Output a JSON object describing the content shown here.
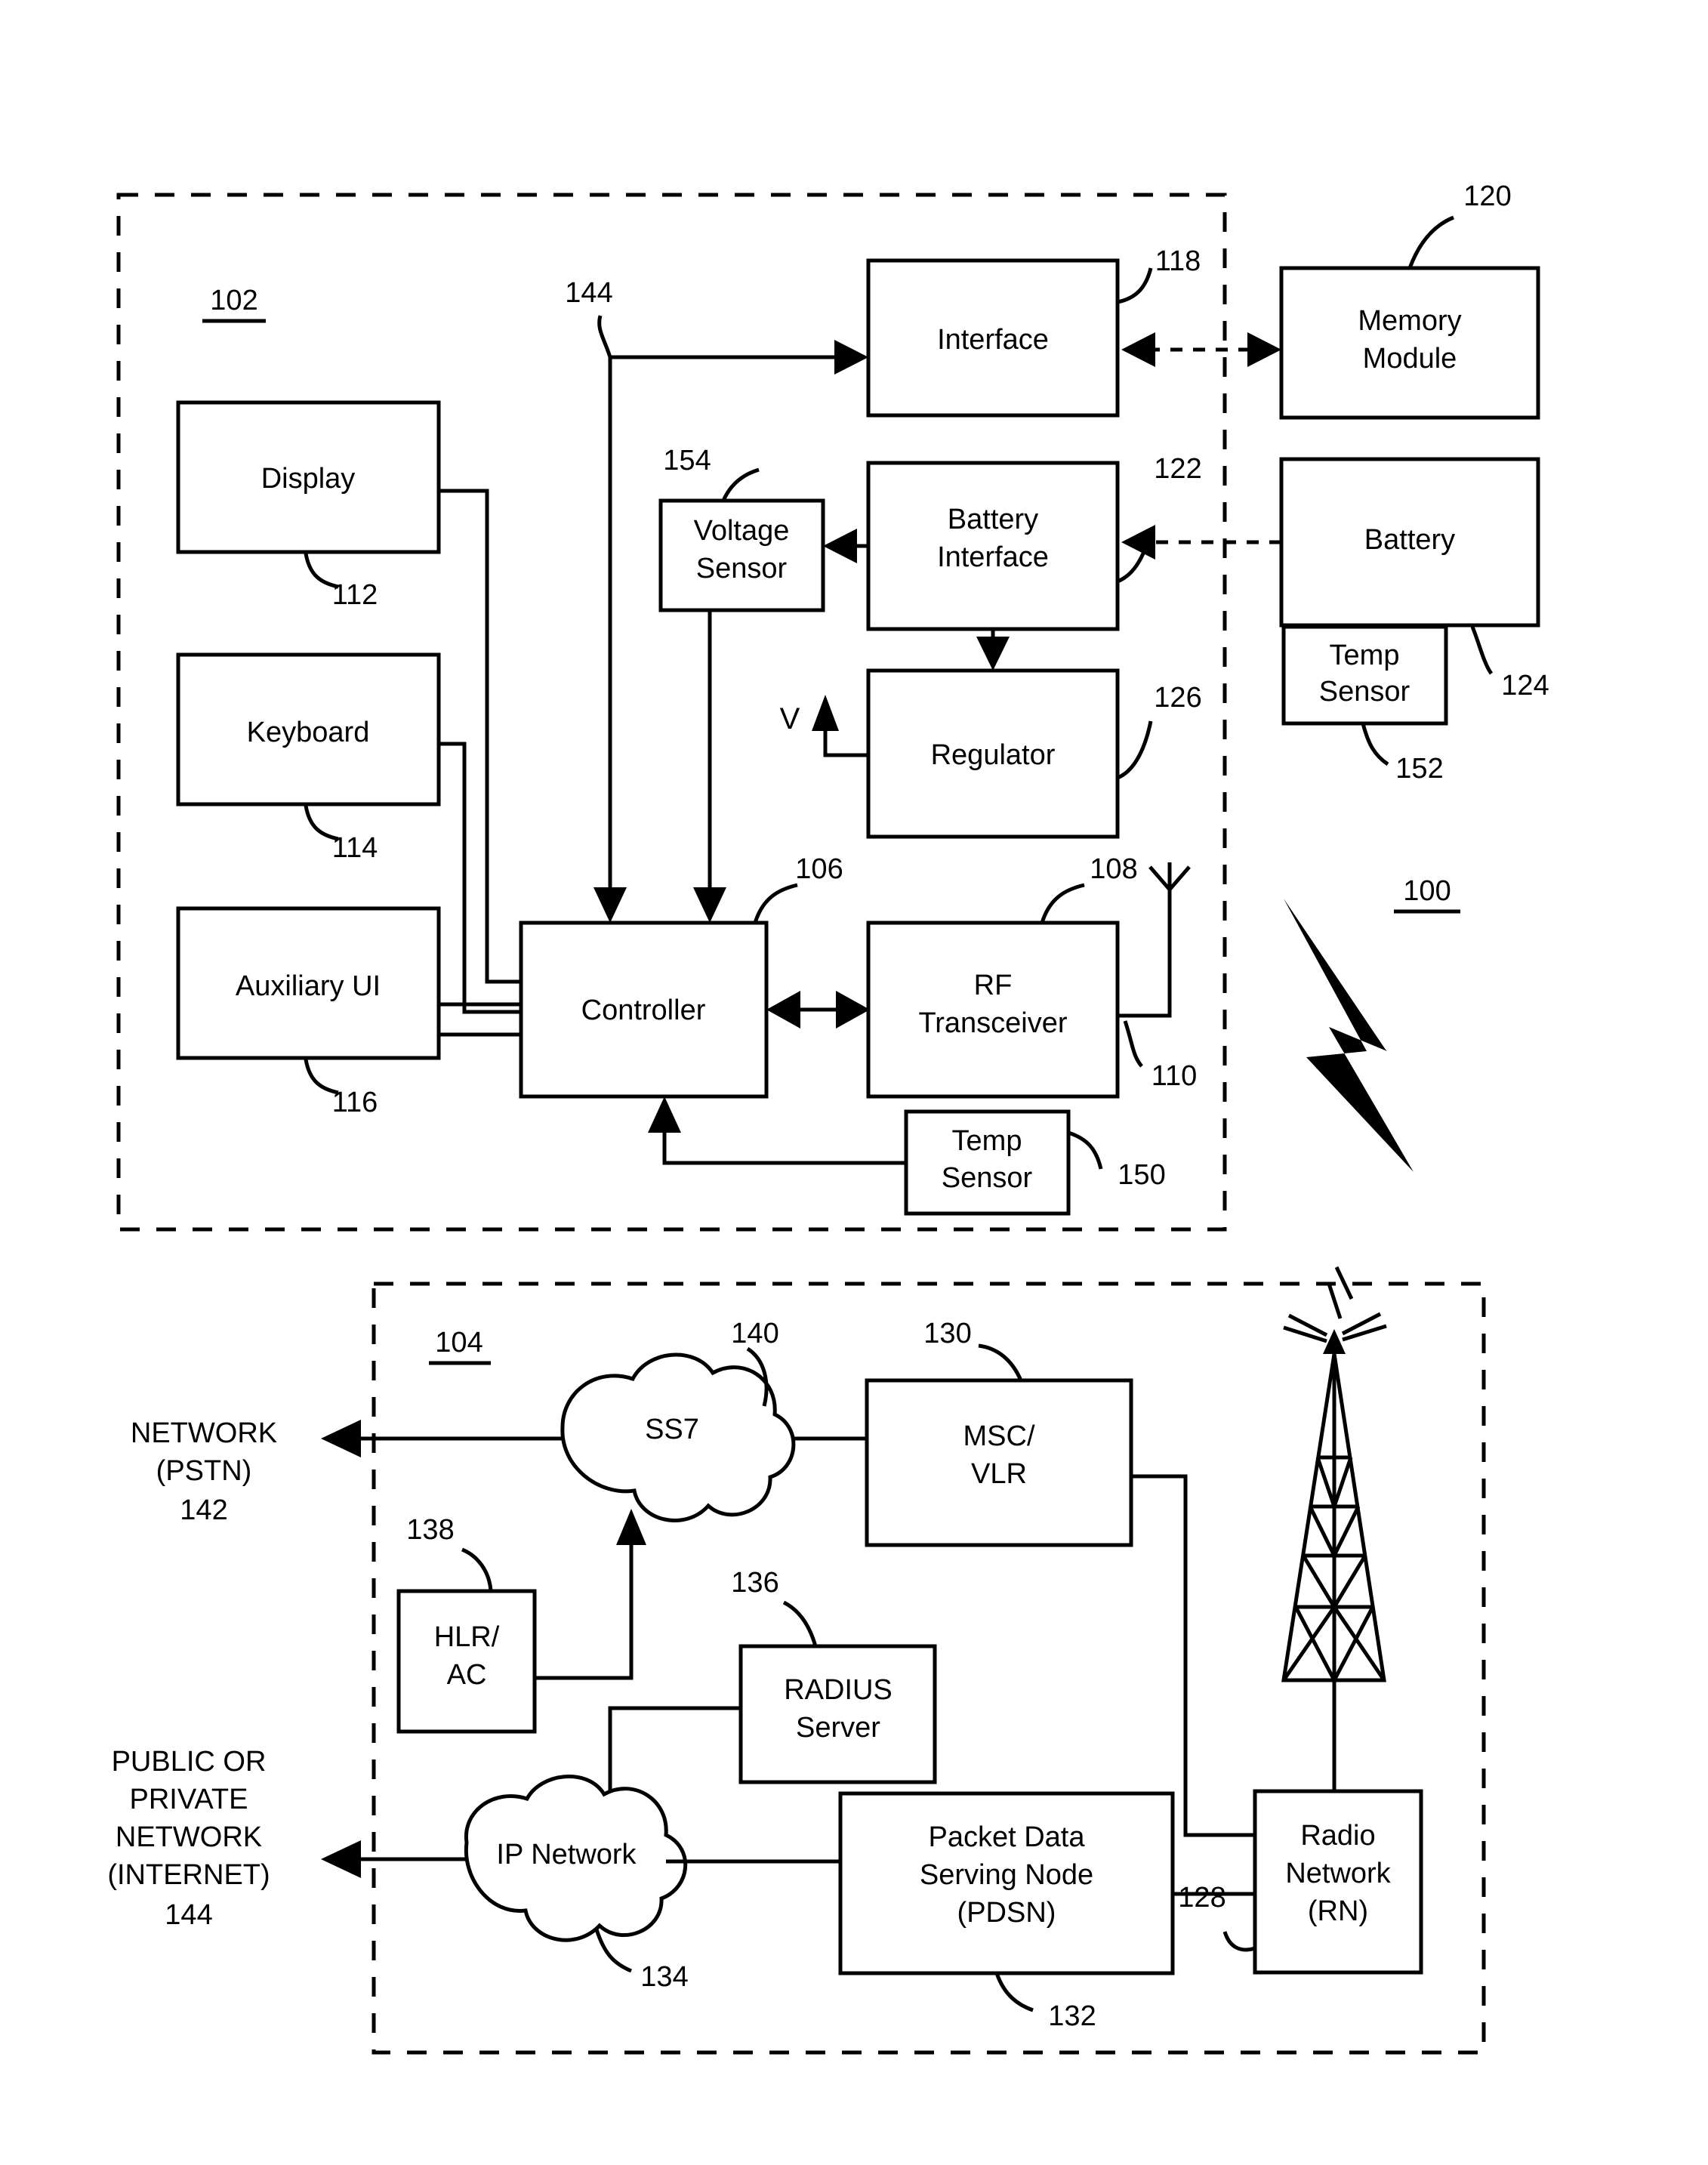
{
  "figure": {
    "type": "patent-block-diagram",
    "overall_ref": "100"
  },
  "mobile_device": {
    "enclosure_ref": "102",
    "blocks": [
      {
        "id": "display",
        "label": "Display",
        "ref": "112"
      },
      {
        "id": "keyboard",
        "label": "Keyboard",
        "ref": "114"
      },
      {
        "id": "auxiliary_ui",
        "label": "Auxiliary UI",
        "ref": "116"
      },
      {
        "id": "controller",
        "label": "Controller",
        "ref": "106"
      },
      {
        "id": "rf_transceiver",
        "label": "RF Transceiver",
        "ref": "108"
      },
      {
        "id": "antenna",
        "label": "",
        "ref": "110"
      },
      {
        "id": "interface",
        "label": "Interface",
        "ref": "118"
      },
      {
        "id": "battery_interface",
        "label": "Battery Interface",
        "ref": "122"
      },
      {
        "id": "voltage_sensor",
        "label": "Voltage Sensor",
        "ref": "154"
      },
      {
        "id": "regulator",
        "label": "Regulator",
        "ref": "126"
      },
      {
        "id": "temp_sensor_dev",
        "label": "Temp Sensor",
        "ref": "150"
      }
    ],
    "bus_ref": "144",
    "regulator_output_label": "V"
  },
  "battery_pack": {
    "blocks": [
      {
        "id": "memory_module",
        "label": "Memory Module",
        "ref": "120"
      },
      {
        "id": "battery",
        "label": "Battery",
        "ref": "124"
      },
      {
        "id": "temp_sensor_batt",
        "label": "Temp Sensor",
        "ref": "152"
      }
    ]
  },
  "network": {
    "enclosure_ref": "104",
    "blocks": [
      {
        "id": "ss7",
        "label": "SS7",
        "ref": "140",
        "shape": "cloud"
      },
      {
        "id": "msc_vlr",
        "label": "MSC/ VLR",
        "ref": "130",
        "shape": "box"
      },
      {
        "id": "hlr_ac",
        "label": "HLR/ AC",
        "ref": "138",
        "shape": "box"
      },
      {
        "id": "radius_server",
        "label": "RADIUS Server",
        "ref": "136",
        "shape": "box"
      },
      {
        "id": "ip_network",
        "label": "IP Network",
        "ref": "134",
        "shape": "cloud"
      },
      {
        "id": "pdsn",
        "label": "Packet Data Serving Node (PDSN)",
        "ref": "132",
        "shape": "box"
      },
      {
        "id": "radio_network",
        "label": "Radio Network (RN)",
        "ref": "128",
        "shape": "box"
      },
      {
        "id": "cell_tower",
        "label": "",
        "ref": "",
        "shape": "tower"
      }
    ],
    "external": [
      {
        "id": "pstn",
        "lines": [
          "NETWORK",
          "(PSTN)"
        ],
        "ref": "142"
      },
      {
        "id": "internet",
        "lines": [
          "PUBLIC OR",
          "PRIVATE",
          "NETWORK",
          "(INTERNET)"
        ],
        "ref": "144"
      }
    ]
  },
  "text": {
    "display": "Display",
    "keyboard": "Keyboard",
    "auxiliary_ui": "Auxiliary UI",
    "controller": "Controller",
    "rf_1": "RF",
    "rf_2": "Transceiver",
    "interface": "Interface",
    "battery_if_1": "Battery",
    "battery_if_2": "Interface",
    "voltage_1": "Voltage",
    "voltage_2": "Sensor",
    "regulator": "Regulator",
    "temp_1": "Temp",
    "temp_2": "Sensor",
    "memory_1": "Memory",
    "memory_2": "Module",
    "battery": "Battery",
    "v_out": "V",
    "ss7": "SS7",
    "msc_1": "MSC/",
    "msc_2": "VLR",
    "hlr_1": "HLR/",
    "hlr_2": "AC",
    "radius_1": "RADIUS",
    "radius_2": "Server",
    "ip_network": "IP Network",
    "pdsn_1": "Packet Data",
    "pdsn_2": "Serving Node",
    "pdsn_3": "(PDSN)",
    "rn_1": "Radio",
    "rn_2": "Network",
    "rn_3": "(RN)",
    "pstn_1": "NETWORK",
    "pstn_2": "(PSTN)",
    "internet_1": "PUBLIC OR",
    "internet_2": "PRIVATE",
    "internet_3": "NETWORK",
    "internet_4": "(INTERNET)"
  },
  "refs": {
    "r100": "100",
    "r102": "102",
    "r104": "104",
    "r106": "106",
    "r108": "108",
    "r110": "110",
    "r112": "112",
    "r114": "114",
    "r116": "116",
    "r118": "118",
    "r120": "120",
    "r122": "122",
    "r124": "124",
    "r126": "126",
    "r128": "128",
    "r130": "130",
    "r132": "132",
    "r134": "134",
    "r136": "136",
    "r138": "138",
    "r140": "140",
    "r142": "142",
    "r144": "144",
    "r144b": "144",
    "r150": "150",
    "r152": "152",
    "r154": "154"
  },
  "colors": {
    "ink": "#000000",
    "paper": "#ffffff"
  }
}
